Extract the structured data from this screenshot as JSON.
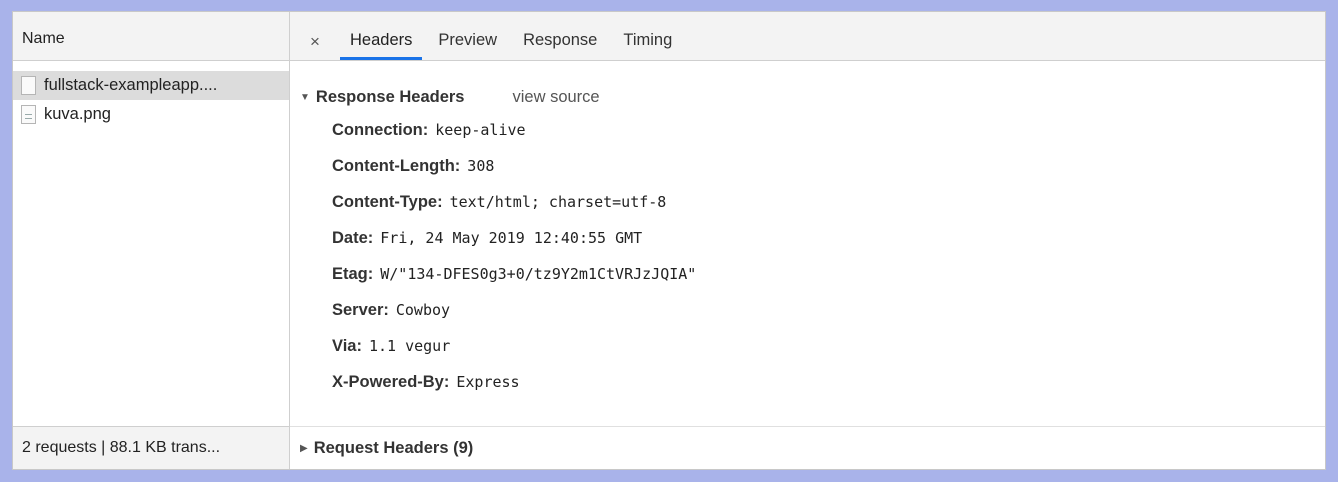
{
  "left": {
    "header": "Name",
    "requests": [
      {
        "name": "fullstack-exampleapp....",
        "selected": true,
        "icon": "document-icon"
      },
      {
        "name": "kuva.png",
        "selected": false,
        "icon": "image-file-icon"
      }
    ],
    "footer": "2 requests | 88.1 KB trans..."
  },
  "tabs": {
    "close": "×",
    "items": [
      "Headers",
      "Preview",
      "Response",
      "Timing"
    ],
    "active": "Headers"
  },
  "response_headers": {
    "title": "Response Headers",
    "view_source": "view source",
    "toggle": "▼",
    "items": [
      {
        "name": "Connection:",
        "value": "keep-alive"
      },
      {
        "name": "Content-Length:",
        "value": "308"
      },
      {
        "name": "Content-Type:",
        "value": "text/html; charset=utf-8"
      },
      {
        "name": "Date:",
        "value": "Fri, 24 May 2019 12:40:55 GMT"
      },
      {
        "name": "Etag:",
        "value": "W/\"134-DFES0g3+0/tz9Y2m1CtVRJzJQIA\""
      },
      {
        "name": "Server:",
        "value": "Cowboy"
      },
      {
        "name": "Via:",
        "value": "1.1 vegur"
      },
      {
        "name": "X-Powered-By:",
        "value": "Express"
      }
    ]
  },
  "request_headers": {
    "toggle": "▶",
    "title": "Request Headers (9)"
  },
  "colors": {
    "frame": "#a9b3ea",
    "active_tab_underline": "#1a73e8"
  }
}
